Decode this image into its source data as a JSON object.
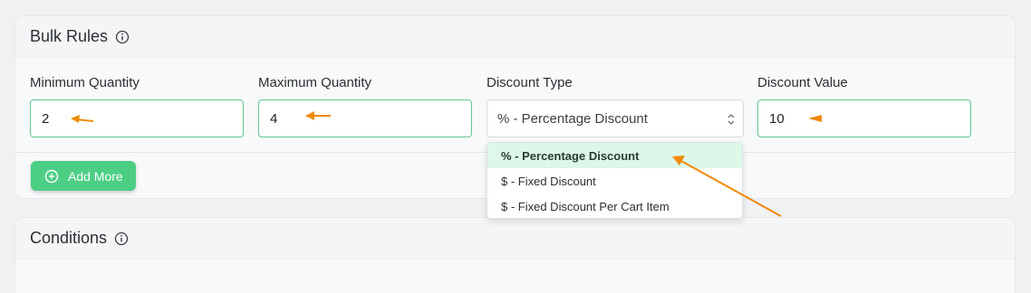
{
  "bulk_rules": {
    "title": "Bulk Rules",
    "info_icon": "info-circle-icon",
    "fields": {
      "min_qty": {
        "label": "Minimum Quantity",
        "value": "2"
      },
      "max_qty": {
        "label": "Maximum Quantity",
        "value": "4"
      },
      "discount_type": {
        "label": "Discount Type",
        "value": "% - Percentage Discount",
        "icon": "up-down-chevron-icon"
      },
      "discount_value": {
        "label": "Discount Value",
        "value": "10"
      }
    },
    "add_more": {
      "label": "Add More",
      "icon": "plus-circle-icon"
    }
  },
  "dropdown": {
    "options": [
      {
        "label": "% - Percentage Discount",
        "selected": true
      },
      {
        "label": "$ - Fixed Discount",
        "selected": false
      },
      {
        "label": "$ - Fixed Discount Per Cart Item",
        "selected": false
      }
    ]
  },
  "conditions": {
    "title": "Conditions",
    "info_icon": "info-circle-icon"
  },
  "colors": {
    "accent_green": "#4ccf85",
    "field_border": "#62c58e",
    "selected_option_bg": "#ddf7e8",
    "annotation_arrow": "#f28a0c"
  }
}
